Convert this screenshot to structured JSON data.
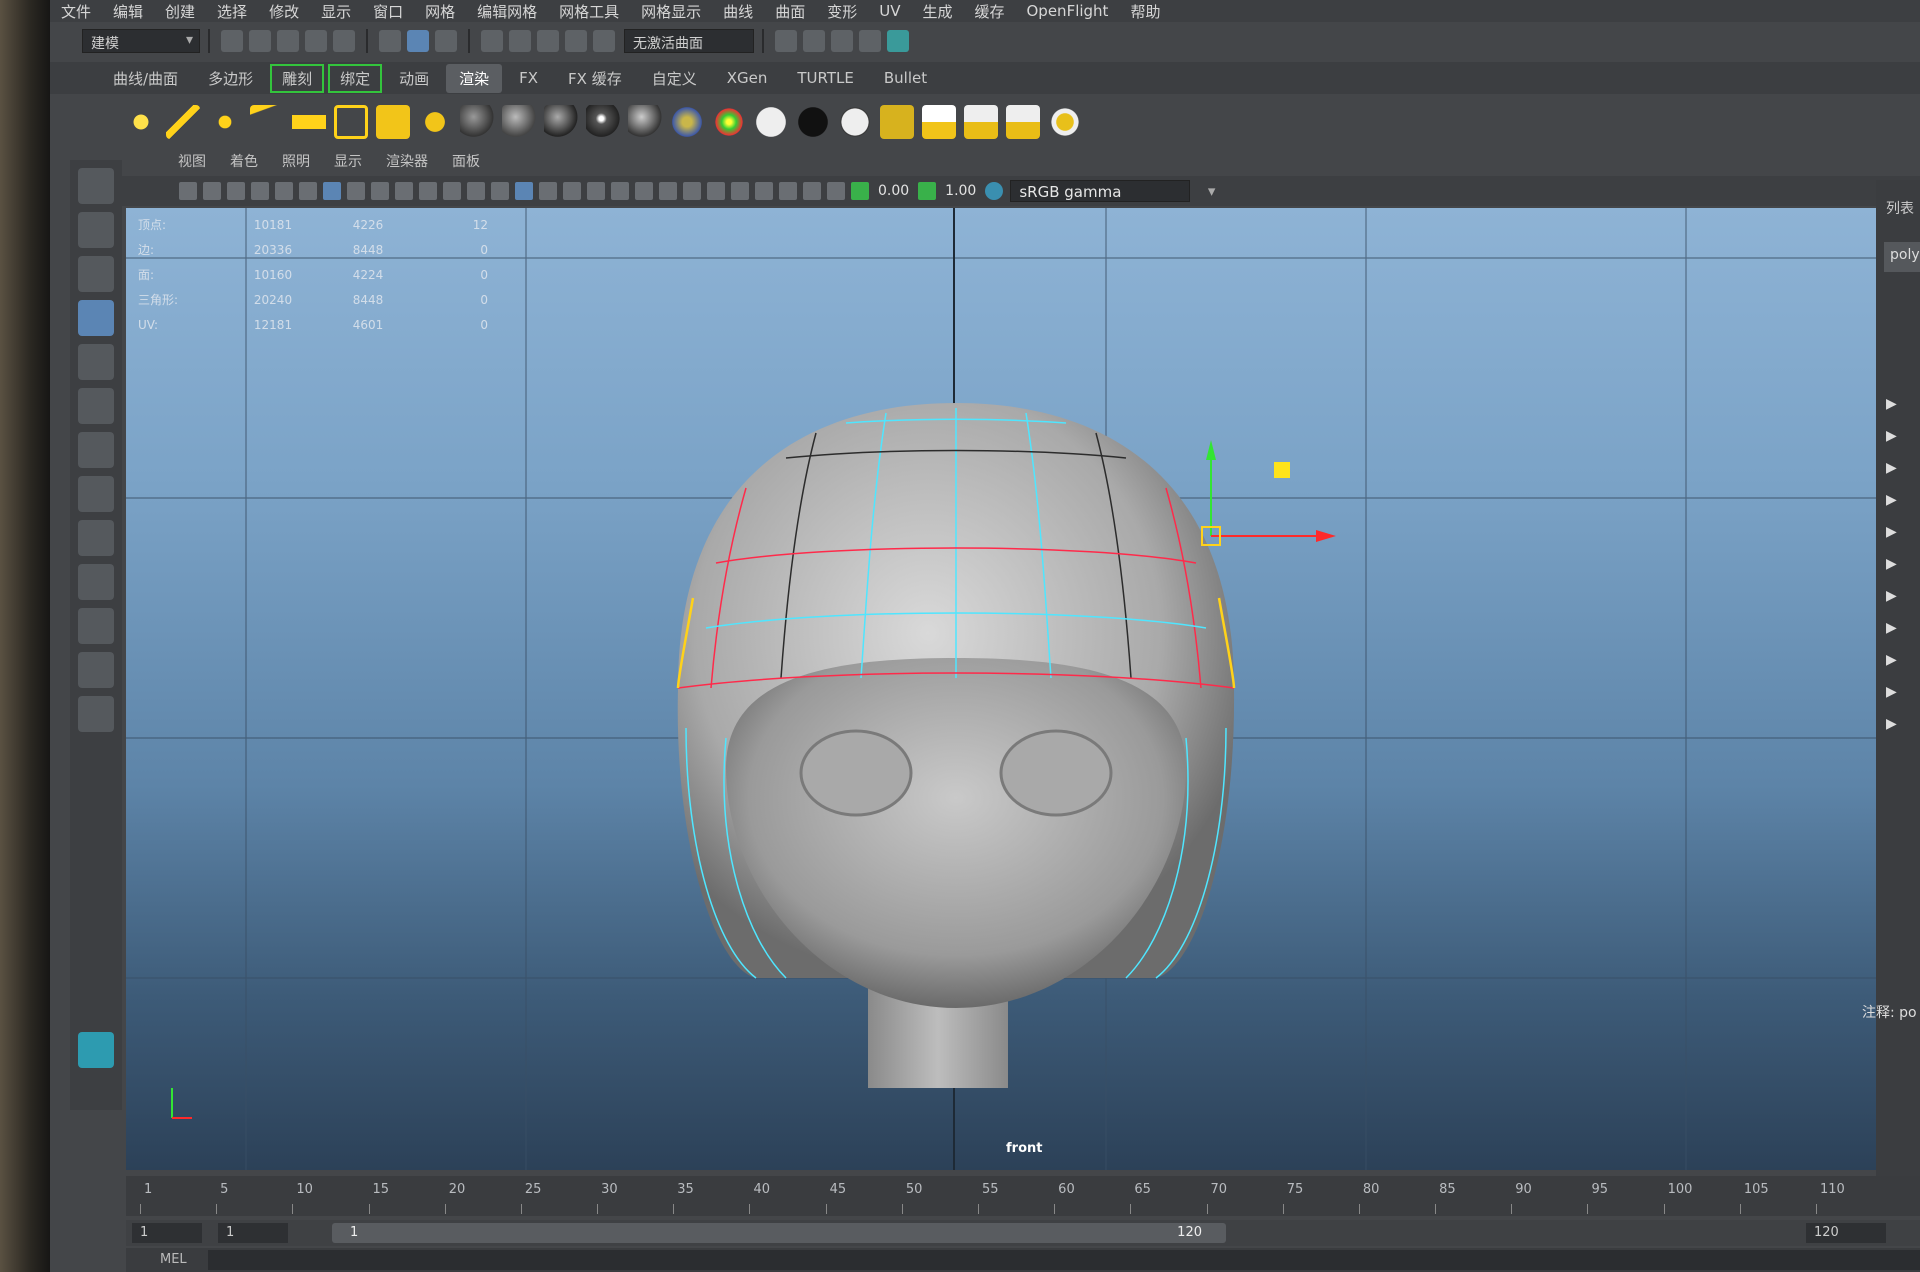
{
  "menubar": [
    "文件",
    "编辑",
    "创建",
    "选择",
    "修改",
    "显示",
    "窗口",
    "网格",
    "编辑网格",
    "网格工具",
    "网格显示",
    "曲线",
    "曲面",
    "变形",
    "UV",
    "生成",
    "缓存",
    "OpenFlight",
    "帮助"
  ],
  "status": {
    "mode": "建模",
    "live_surface": "无激活曲面"
  },
  "shelf_tabs": [
    "曲线/曲面",
    "多边形",
    "雕刻",
    "绑定",
    "动画",
    "渲染",
    "FX",
    "FX 缓存",
    "自定义",
    "XGen",
    "TURTLE",
    "Bullet"
  ],
  "shelf_active": "渲染",
  "panel_menu": [
    "视图",
    "着色",
    "照明",
    "显示",
    "渲染器",
    "面板"
  ],
  "panel_toolbar": {
    "exposure": "0.00",
    "gamma": "1.00",
    "color_space": "sRGB gamma"
  },
  "hud": {
    "rows": [
      {
        "label": "顶点:",
        "c1": "10181",
        "c2": "4226",
        "c3": "12"
      },
      {
        "label": "边:",
        "c1": "20336",
        "c2": "8448",
        "c3": "0"
      },
      {
        "label": "面:",
        "c1": "10160",
        "c2": "4224",
        "c3": "0"
      },
      {
        "label": "三角形:",
        "c1": "20240",
        "c2": "8448",
        "c3": "0"
      },
      {
        "label": "UV:",
        "c1": "12181",
        "c2": "4601",
        "c3": "0"
      }
    ]
  },
  "viewport": {
    "camera_label": "front"
  },
  "right_panel": {
    "list_label": "列表",
    "node_name": "poly",
    "notes_label": "注释: po"
  },
  "time_slider": {
    "ticks": [
      "1",
      "5",
      "10",
      "15",
      "20",
      "25",
      "30",
      "35",
      "40",
      "45",
      "50",
      "55",
      "60",
      "65",
      "70",
      "75",
      "80",
      "85",
      "90",
      "95",
      "100",
      "105",
      "110"
    ]
  },
  "range": {
    "start": "1",
    "inner_start": "1",
    "slider_start": "1",
    "slider_end": "120",
    "end": "120"
  },
  "command_line": {
    "type": "MEL"
  },
  "colors": {
    "viewport_top": "#8eb3d5",
    "viewport_bottom": "#2c4158",
    "wire_cyan": "#4fe6ff",
    "wire_red": "#ff2a4a",
    "wire_magenta": "#e24bd6",
    "wire_yellow": "#ffd21a"
  }
}
